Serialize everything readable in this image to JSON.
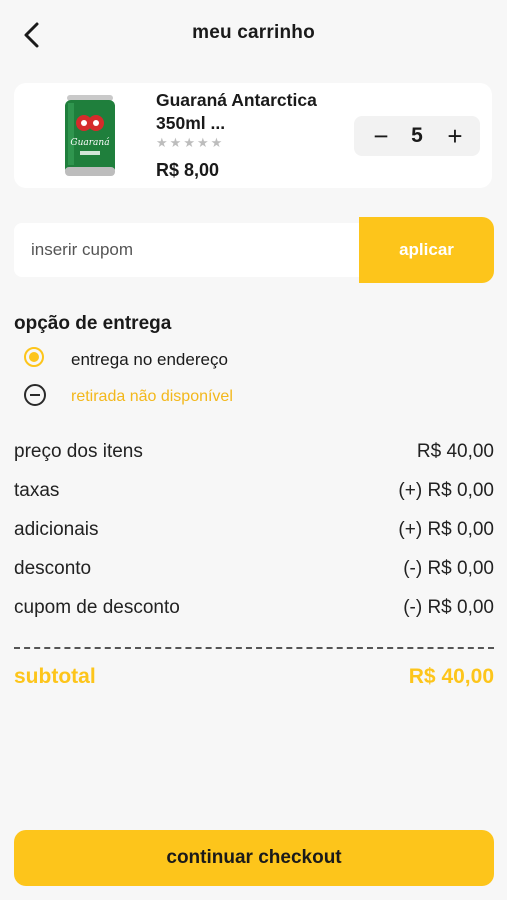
{
  "header": {
    "title": "meu carrinho",
    "back_icon": "chevron-left-icon"
  },
  "cart_item": {
    "name": "Guaraná Antarctica 350ml ...",
    "rating": 0,
    "max_rating": 5,
    "price": "R$ 8,00",
    "quantity": "5",
    "minus_label": "−",
    "plus_label": "+",
    "image_brand": "Guaraná"
  },
  "coupon": {
    "placeholder": "inserir cupom",
    "value": "",
    "apply_label": "aplicar"
  },
  "delivery": {
    "title": "opção de entrega",
    "options": [
      {
        "label": "entrega no endereço",
        "selected": true
      },
      {
        "label": "retirada não disponível",
        "disabled": true
      }
    ]
  },
  "summary": {
    "rows": [
      {
        "label": "preço dos itens",
        "value": "R$ 40,00"
      },
      {
        "label": "taxas",
        "value": "(+) R$ 0,00"
      },
      {
        "label": "adicionais",
        "value": "(+) R$ 0,00"
      },
      {
        "label": "desconto",
        "value": "(-) R$ 0,00"
      },
      {
        "label": "cupom de desconto",
        "value": "(-) R$ 0,00"
      }
    ],
    "subtotal_label": "subtotal",
    "subtotal_value": "R$ 40,00"
  },
  "checkout": {
    "label": "continuar checkout"
  },
  "colors": {
    "accent": "#fdc51b",
    "disabled_text": "#f3b81c",
    "background": "#f7f7f7",
    "can_green": "#1f7f3c"
  }
}
